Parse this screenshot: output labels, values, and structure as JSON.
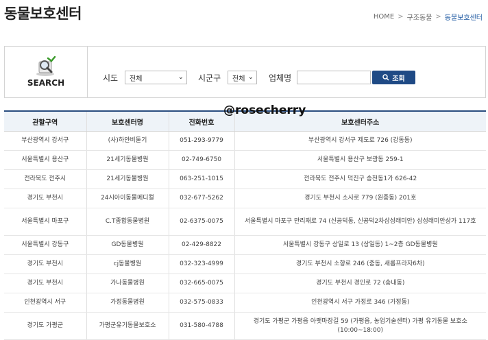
{
  "page": {
    "title": "동물보호센터",
    "breadcrumb": [
      "HOME",
      "구조동물",
      "동물보호센터"
    ]
  },
  "search": {
    "label": "SEARCH",
    "sido_label": "시도",
    "sido_value": "전체",
    "sigungu_label": "시군구",
    "sigungu_value": "전체",
    "company_label": "업체명",
    "company_value": "",
    "button_label": "조회"
  },
  "watermark": "@rosecherry",
  "table": {
    "headers": [
      "관할구역",
      "보호센터명",
      "전화번호",
      "보호센터주소"
    ],
    "rows": [
      {
        "region": "부산광역시 강서구",
        "name": "(사)하얀비둘기",
        "phone": "051-293-9779",
        "address": "부산광역시 강서구 제도로 726 (강동동)"
      },
      {
        "region": "서울특별시 용산구",
        "name": "21세기동물병원",
        "phone": "02-749-6750",
        "address": "서울특별시 용산구 보광동 259-1"
      },
      {
        "region": "전라북도 전주시",
        "name": "21세기동물병원",
        "phone": "063-251-1015",
        "address": "전라북도 전주시 덕진구 송천동1가 626-42"
      },
      {
        "region": "경기도 부천시",
        "name": "24시아이동물메디컬",
        "phone": "032-677-5262",
        "address": "경기도 부천시 소사로 779 (원종동) 201호"
      },
      {
        "region": "서울특별시 마포구",
        "name": "C.T종합동물병원",
        "phone": "02-6375-0075",
        "address": "서울특별시 마포구 만리재로 74 (신공덕동, 신공덕2차삼성래미안) 삼성래미안상가 117호"
      },
      {
        "region": "서울특별시 강동구",
        "name": "GD동물병원",
        "phone": "02-429-8822",
        "address": "서울특별시 강동구 상일로 13 (상일동) 1~2층 GD동물병원"
      },
      {
        "region": "경기도 부천시",
        "name": "cj동물병원",
        "phone": "032-323-4999",
        "address": "경기도 부천시 소향로 246 (중동, 새롬프라자6차)"
      },
      {
        "region": "경기도 부천시",
        "name": "가나동물병원",
        "phone": "032-665-0075",
        "address": "경기도 부천시 경인로 72 (송내동)"
      },
      {
        "region": "인천광역시 서구",
        "name": "가정동물병원",
        "phone": "032-575-0833",
        "address": "인천광역시 서구 가정로 346 (가정동)"
      },
      {
        "region": "경기도 가평군",
        "name": "가평군유기동물보호소",
        "phone": "031-580-4788",
        "address": "경기도 가평군 가평읍 아랫마장길 59 (가평읍, 농업기술센터) 가평 유기동물 보호소(10:00~18:00)"
      }
    ]
  },
  "colors": {
    "accent": "#1f4a85",
    "header_bg": "#eef3f8",
    "breadcrumb_current": "#1a56a0"
  }
}
